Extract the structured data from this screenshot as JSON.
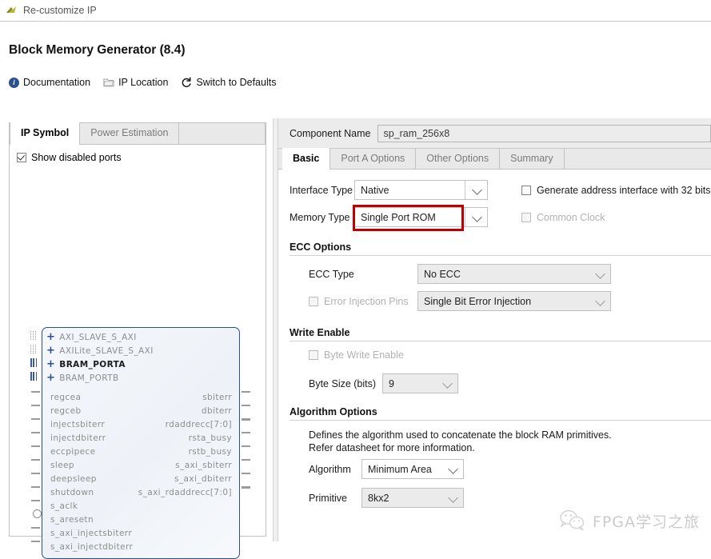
{
  "window": {
    "title": "Re-customize IP",
    "logo_icon": "xilinx-logo-icon"
  },
  "header": {
    "page_title": "Block Memory Generator (8.4)",
    "toolbar": [
      {
        "label": "Documentation",
        "icon": "info-icon"
      },
      {
        "label": "IP Location",
        "icon": "folder-icon"
      },
      {
        "label": "Switch to Defaults",
        "icon": "refresh-icon"
      }
    ]
  },
  "left_panel": {
    "tabs": [
      {
        "label": "IP Symbol",
        "active": true
      },
      {
        "label": "Power Estimation",
        "active": false
      }
    ],
    "show_disabled_ports": {
      "label": "Show disabled ports",
      "checked": true
    },
    "symbol": {
      "buses": [
        {
          "label": "AXI_SLAVE_S_AXI",
          "enabled": false,
          "stub": "dotted"
        },
        {
          "label": "AXILite_SLAVE_S_AXI",
          "enabled": false,
          "stub": "dotted"
        },
        {
          "label": "BRAM_PORTA",
          "enabled": true,
          "stub": "solid"
        },
        {
          "label": "BRAM_PORTB",
          "enabled": false,
          "stub": "solid"
        }
      ],
      "left_ports": [
        {
          "label": "regcea",
          "type": "pin"
        },
        {
          "label": "regceb",
          "type": "pin"
        },
        {
          "label": "injectsbiterr",
          "type": "pin"
        },
        {
          "label": "injectdbiterr",
          "type": "pin"
        },
        {
          "label": "eccpipece",
          "type": "pin"
        },
        {
          "label": "sleep",
          "type": "pin"
        },
        {
          "label": "deepsleep",
          "type": "pin"
        },
        {
          "label": "shutdown",
          "type": "pin"
        },
        {
          "label": "s_aclk",
          "type": "pin"
        },
        {
          "label": "s_aresetn",
          "type": "clock"
        },
        {
          "label": "s_axi_injectsbiterr",
          "type": "pin"
        },
        {
          "label": "s_axi_injectdbiterr",
          "type": "pin"
        }
      ],
      "right_ports": [
        {
          "label": "sbiterr",
          "type": "pin"
        },
        {
          "label": "dbiterr",
          "type": "pin"
        },
        {
          "label": "rdaddrecc[7:0]",
          "type": "bus"
        },
        {
          "label": "rsta_busy",
          "type": "pin"
        },
        {
          "label": "rstb_busy",
          "type": "pin"
        },
        {
          "label": "s_axi_sbiterr",
          "type": "pin"
        },
        {
          "label": "s_axi_dbiterr",
          "type": "pin"
        },
        {
          "label": "s_axi_rdaddrecc[7:0]",
          "type": "bus"
        }
      ]
    }
  },
  "right_panel": {
    "component_name": {
      "label": "Component Name",
      "value": "sp_ram_256x8"
    },
    "tabs": [
      {
        "label": "Basic",
        "active": true
      },
      {
        "label": "Port A Options",
        "active": false
      },
      {
        "label": "Other Options",
        "active": false
      },
      {
        "label": "Summary",
        "active": false
      }
    ],
    "basic": {
      "interface_type": {
        "label": "Interface Type",
        "value": "Native"
      },
      "memory_type": {
        "label": "Memory Type",
        "value": "Single Port ROM",
        "highlighted": true,
        "highlight_color": "#c00000"
      },
      "generate_address_interface": {
        "label": "Generate address interface with 32 bits",
        "checked": false,
        "disabled": false
      },
      "common_clock": {
        "label": "Common Clock",
        "checked": false,
        "disabled": true
      },
      "ecc_options": {
        "title": "ECC Options",
        "ecc_type": {
          "label": "ECC Type",
          "value": "No ECC"
        },
        "error_injection_pins": {
          "label": "Error Injection Pins",
          "checked": false,
          "disabled": true
        },
        "error_injection_type": {
          "value": "Single Bit Error Injection"
        }
      },
      "write_enable": {
        "title": "Write Enable",
        "byte_write_enable": {
          "label": "Byte Write Enable",
          "checked": false,
          "disabled": true
        },
        "byte_size": {
          "label": "Byte Size (bits)",
          "value": "9"
        }
      },
      "algorithm_options": {
        "title": "Algorithm Options",
        "description_line1": "Defines the algorithm used to concatenate the block RAM primitives.",
        "description_line2": "Refer datasheet for more information.",
        "algorithm": {
          "label": "Algorithm",
          "value": "Minimum Area"
        },
        "primitive": {
          "label": "Primitive",
          "value": "8kx2"
        }
      }
    }
  },
  "watermark": {
    "text": "FPGA学习之旅",
    "icon": "wechat-icon"
  }
}
